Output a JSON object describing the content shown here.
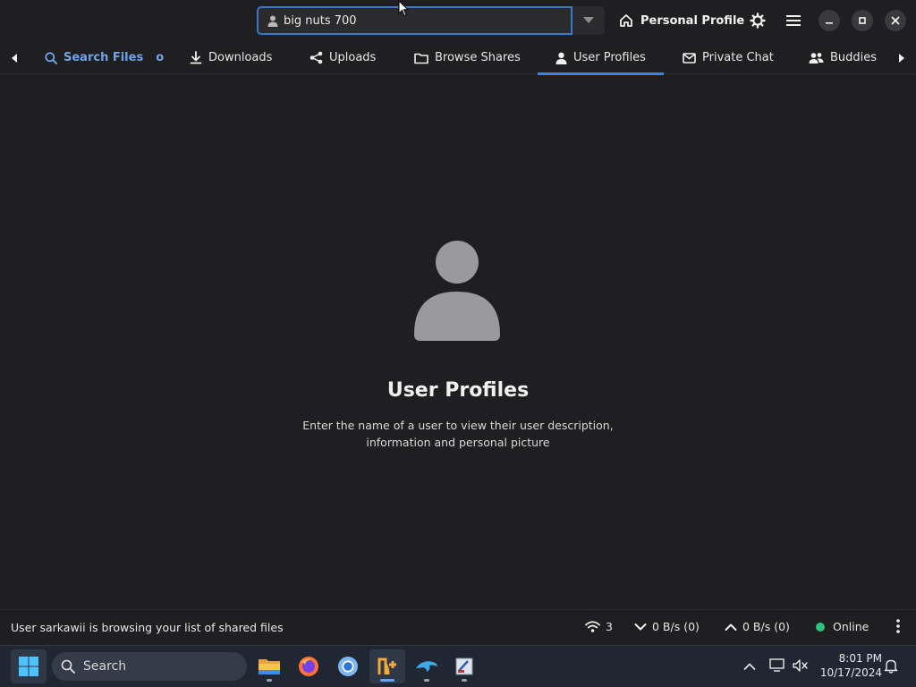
{
  "header": {
    "user_entry_value": "big nuts 700",
    "personal_profile_label": "Personal Profile"
  },
  "tabs": [
    {
      "label": "Search Files",
      "icon": "search-icon",
      "badge": "o"
    },
    {
      "label": "Downloads",
      "icon": "download-icon"
    },
    {
      "label": "Uploads",
      "icon": "share-icon"
    },
    {
      "label": "Browse Shares",
      "icon": "folder-icon"
    },
    {
      "label": "User Profiles",
      "icon": "user-icon",
      "active": true
    },
    {
      "label": "Private Chat",
      "icon": "mail-icon"
    },
    {
      "label": "Buddies",
      "icon": "buddies-icon"
    }
  ],
  "placeholder": {
    "title": "User Profiles",
    "description_line1": "Enter the name of a user to view their user description,",
    "description_line2": "information and personal picture"
  },
  "status": {
    "message": "User sarkawii is browsing your list of shared files",
    "connections": "3",
    "download_speed": "0 B/s (0)",
    "upload_speed": "0 B/s (0)",
    "online_label": "Online",
    "online_color": "#2ec27e"
  },
  "taskbar": {
    "search_label": "Search",
    "time": "8:01 PM",
    "date": "10/17/2024"
  },
  "colors": {
    "accent": "#3d82dc",
    "background": "#1f1f21",
    "search_tab": "#6ea4e8"
  }
}
